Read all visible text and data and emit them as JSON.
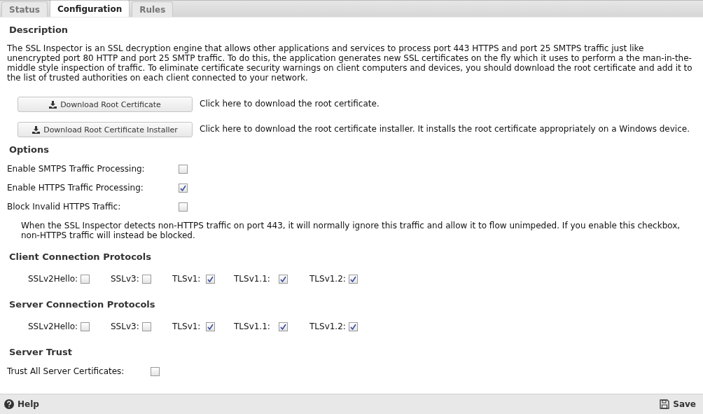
{
  "tabs": [
    {
      "label": "Status",
      "selected": false
    },
    {
      "label": "Configuration",
      "selected": true
    },
    {
      "label": "Rules",
      "selected": false
    }
  ],
  "description": {
    "heading": "Description",
    "text": "The SSL Inspector is an SSL decryption engine that allows other applications and services to process port 443 HTTPS and port 25 SMTPS traffic just like unencrypted port 80 HTTP and port 25 SMTP traffic. To do this, the application generates new SSL certificates on the fly which it uses to perform a the man-in-the-middle style inspection of traffic. To eliminate certificate security warnings on client computers and devices, you should download the root certificate and add it to the list of trusted authorities on each client connected to your network."
  },
  "downloads": [
    {
      "button": "Download Root Certificate",
      "text": "Click here to download the root certificate."
    },
    {
      "button": "Download Root Certificate Installer",
      "text": "Click here to download the root certificate installer. It installs the root certificate appropriately on a Windows device."
    }
  ],
  "options": {
    "heading": "Options",
    "items": [
      {
        "label": "Enable SMTPS Traffic Processing:",
        "checked": false
      },
      {
        "label": "Enable HTTPS Traffic Processing:",
        "checked": true
      },
      {
        "label": "Block Invalid HTTPS Traffic:",
        "checked": false
      }
    ],
    "note": "When the SSL Inspector detects non-HTTPS traffic on port 443, it will normally ignore this traffic and allow it to flow unimpeded. If you enable this checkbox, non-HTTPS traffic will instead be blocked."
  },
  "protocol_groups": [
    {
      "heading": "Client Connection Protocols",
      "items": [
        {
          "label": "SSLv2Hello:",
          "checked": false
        },
        {
          "label": "SSLv3:",
          "checked": false
        },
        {
          "label": "TLSv1:",
          "checked": true
        },
        {
          "label": "TLSv1.1:",
          "checked": true
        },
        {
          "label": "TLSv1.2:",
          "checked": true
        }
      ]
    },
    {
      "heading": "Server Connection Protocols",
      "items": [
        {
          "label": "SSLv2Hello:",
          "checked": false
        },
        {
          "label": "SSLv3:",
          "checked": false
        },
        {
          "label": "TLSv1:",
          "checked": true
        },
        {
          "label": "TLSv1.1:",
          "checked": true
        },
        {
          "label": "TLSv1.2:",
          "checked": true
        }
      ]
    }
  ],
  "server_trust": {
    "heading": "Server Trust",
    "label": "Trust All Server Certificates:",
    "checked": false
  },
  "footer": {
    "help": "Help",
    "save": "Save"
  }
}
